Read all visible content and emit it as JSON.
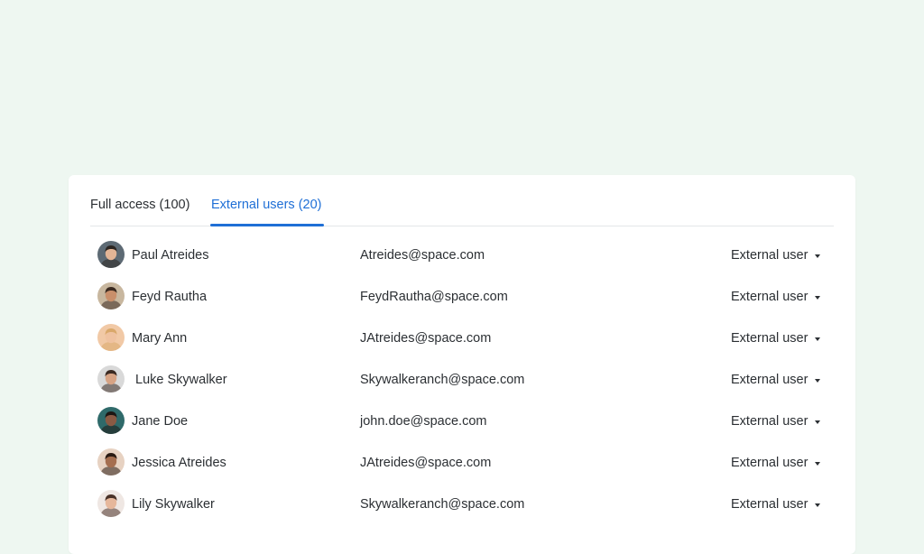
{
  "tabs": {
    "full_access": "Full access (100)",
    "external_users": "External users (20)"
  },
  "colors": {
    "background": "#eef7f1",
    "accent": "#1f6fd6",
    "text": "#2b2f33"
  },
  "users": [
    {
      "name": "Paul Atreides",
      "email": "Atreides@space.com",
      "role": "External user",
      "avatar": {
        "bg": "#5d6a74",
        "skin": "#e3b596",
        "hair": "#2c2622"
      }
    },
    {
      "name": "Feyd Rautha",
      "email": "FeydRautha@space.com",
      "role": "External user",
      "avatar": {
        "bg": "#c8b79f",
        "skin": "#c98f6b",
        "hair": "#3a2a20"
      }
    },
    {
      "name": "Mary Ann",
      "email": "JAtreides@space.com",
      "role": "External user",
      "avatar": {
        "bg": "#f1c9a6",
        "skin": "#efc2a0",
        "hair": "#d9a86a"
      }
    },
    {
      "name": " Luke Skywalker",
      "email": "Skywalkeranch@space.com",
      "role": "External user",
      "avatar": {
        "bg": "#d9d9d9",
        "skin": "#d7a384",
        "hair": "#3b2a22"
      }
    },
    {
      "name": "Jane Doe",
      "email": "john.doe@space.com",
      "role": "External user",
      "avatar": {
        "bg": "#2f6a6a",
        "skin": "#8a5a44",
        "hair": "#1d1714"
      }
    },
    {
      "name": "Jessica Atreides",
      "email": "JAtreides@space.com",
      "role": "External user",
      "avatar": {
        "bg": "#e7d2c2",
        "skin": "#a56e4f",
        "hair": "#2a1a12"
      }
    },
    {
      "name": "Lily Skywalker",
      "email": "Skywalkeranch@space.com",
      "role": "External user",
      "avatar": {
        "bg": "#efe7e3",
        "skin": "#e6b79b",
        "hair": "#4a3228"
      }
    }
  ]
}
